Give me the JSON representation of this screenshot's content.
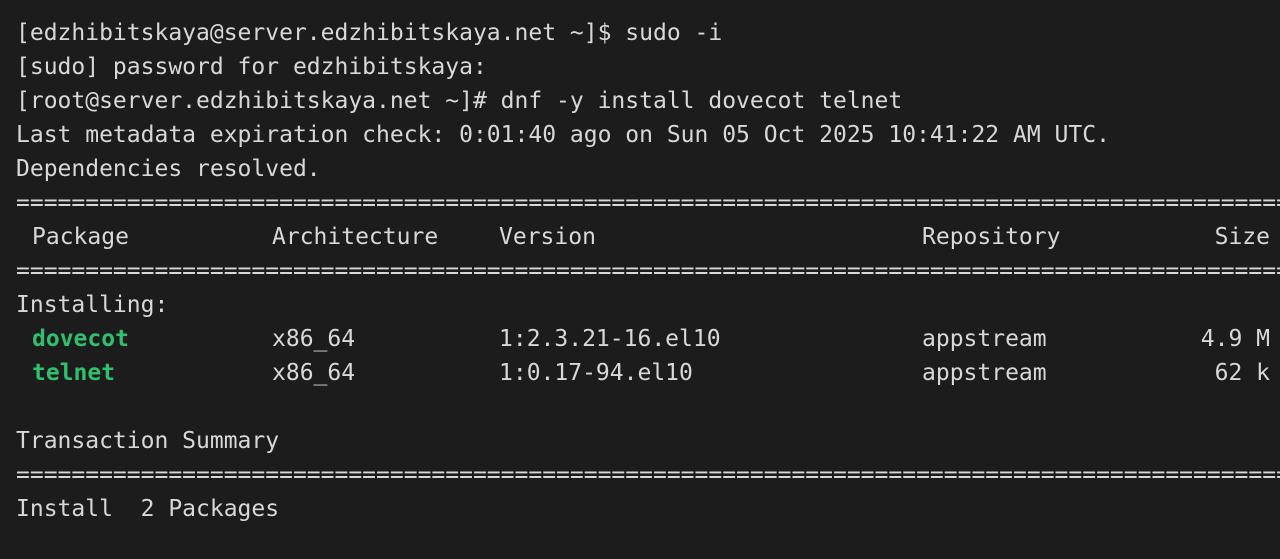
{
  "terminal": {
    "line_1": "[edzhibitskaya@server.edzhibitskaya.net ~]$ sudo -i",
    "line_2": "[sudo] password for edzhibitskaya:",
    "line_3": "[root@server.edzhibitskaya.net ~]# dnf -y install dovecot telnet",
    "line_4": "Last metadata expiration check: 0:01:40 ago on Sun 05 Oct 2025 10:41:22 AM UTC.",
    "line_5": "Dependencies resolved.",
    "rule": "==================================================================================================================================",
    "headers": {
      "package": "Package",
      "architecture": "Architecture",
      "version": "Version",
      "repository": "Repository",
      "size": "Size"
    },
    "installing_label": "Installing:",
    "packages": [
      {
        "name": "dovecot",
        "arch": "x86_64",
        "version": "1:2.3.21-16.el10",
        "repo": "appstream",
        "size": "4.9 M"
      },
      {
        "name": "telnet",
        "arch": "x86_64",
        "version": "1:0.17-94.el10",
        "repo": "appstream",
        "size": "62 k"
      }
    ],
    "summary_label": "Transaction Summary",
    "install_line": "Install  2 Packages",
    "colors": {
      "background": "#1c1c1c",
      "text": "#d8d8d8",
      "package_name": "#2fbf6f"
    }
  }
}
